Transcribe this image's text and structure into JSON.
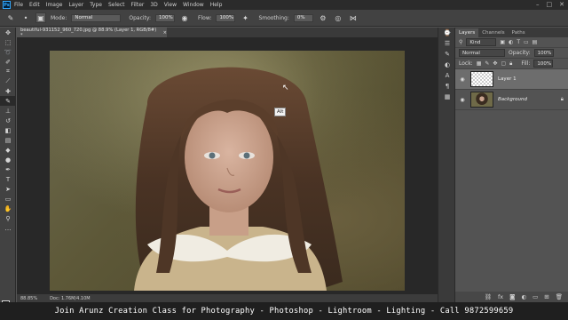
{
  "app": {
    "logo_text": "Ps"
  },
  "menu": [
    "File",
    "Edit",
    "Image",
    "Layer",
    "Type",
    "Select",
    "Filter",
    "3D",
    "View",
    "Window",
    "Help"
  ],
  "options_bar": {
    "mode_label": "Mode:",
    "mode_value": "Normal",
    "opacity_label": "Opacity:",
    "opacity_value": "100%",
    "flow_label": "Flow:",
    "flow_value": "100%",
    "smoothing_label": "Smoothing:",
    "smoothing_value": "0%"
  },
  "document": {
    "tab_title": "beautiful-931152_960_720.jpg @ 88.9% (Layer 1, RGB/8#) *",
    "tab_close": "×",
    "tooltip": "Alt",
    "status_zoom": "88.85%",
    "status_doc": "Doc: 1.76M/4.10M"
  },
  "layers_panel": {
    "tabs": [
      "Layers",
      "Channels",
      "Paths"
    ],
    "active_tab": "Layers",
    "filter_kind": "Kind",
    "blend_mode": "Normal",
    "opacity_label": "Opacity:",
    "opacity_value": "100%",
    "lock_label": "Lock:",
    "fill_label": "Fill:",
    "fill_value": "100%",
    "layers": [
      {
        "name": "Layer 1",
        "selected": true
      },
      {
        "name": "Background",
        "selected": false
      }
    ]
  },
  "caption": "Join Arunz Creation Class for Photography - Photoshop - Lightroom - Lighting - Call 9872599659"
}
